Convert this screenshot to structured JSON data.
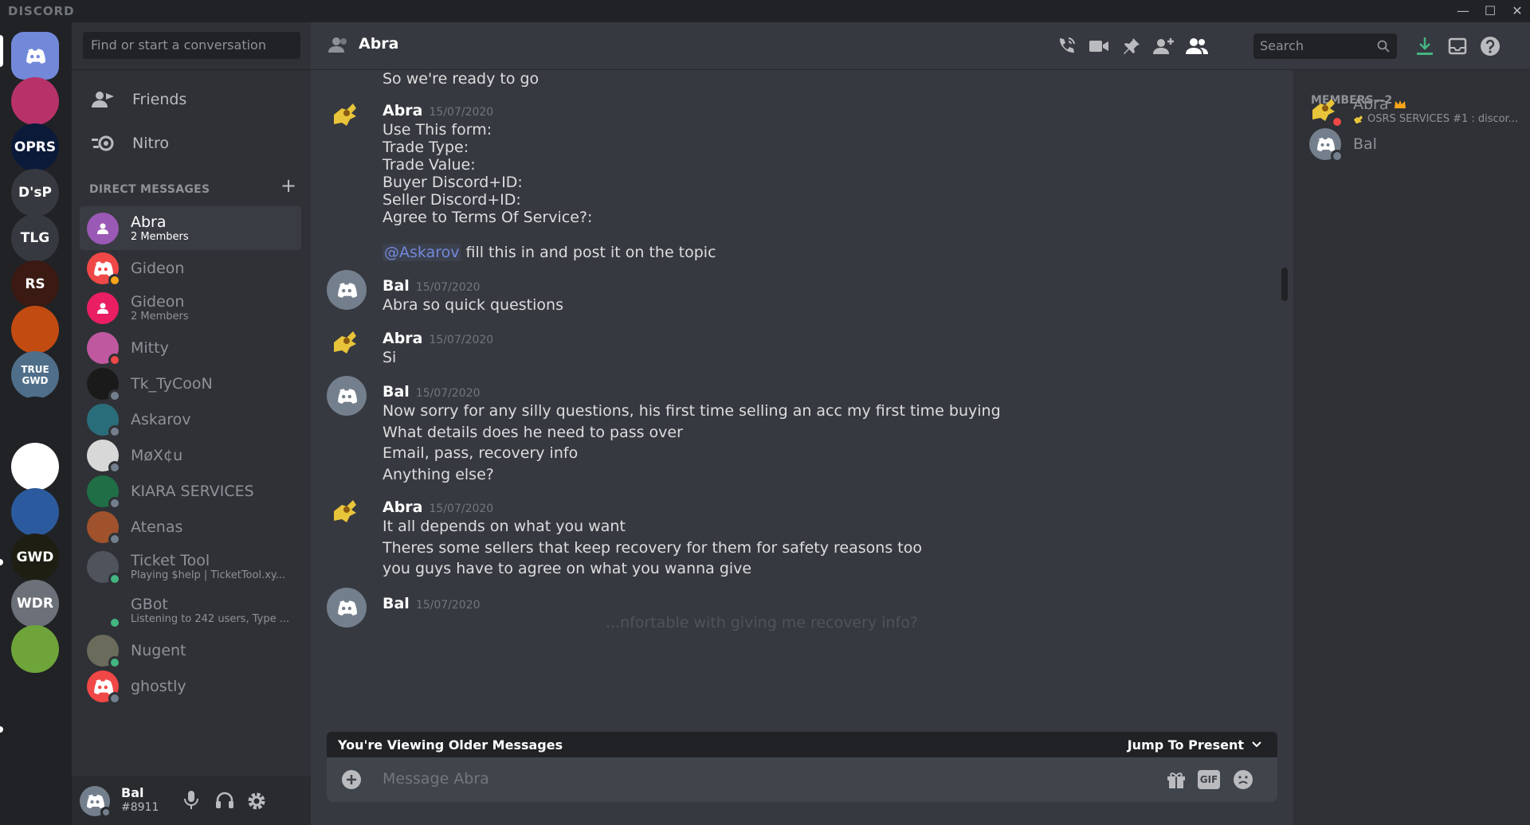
{
  "window": {
    "brand": "DISCORD",
    "minimize": "—",
    "maximize": "☐",
    "close": "✕"
  },
  "servers": [
    {
      "id": "home",
      "label": "",
      "color": "#7289da"
    },
    {
      "id": "s1",
      "label": "",
      "color": "#b8326a"
    },
    {
      "id": "s2",
      "label": "OPRS",
      "color": "#0c1a3a"
    },
    {
      "id": "s3",
      "label": "D'sP",
      "color": "#36393f"
    },
    {
      "id": "s4",
      "label": "TLG",
      "color": "#36393f"
    },
    {
      "id": "s5",
      "label": "RS",
      "color": "#3a1a12"
    },
    {
      "id": "s6",
      "label": "",
      "color": "#c24b12"
    },
    {
      "id": "s7",
      "label": "TRUE GWD",
      "color": "#4f6e8a"
    },
    {
      "id": "s8",
      "label": "",
      "color": "#202225"
    },
    {
      "id": "s9",
      "label": "",
      "color": "#ffffff"
    },
    {
      "id": "s10",
      "label": "",
      "color": "#2c5a9e"
    },
    {
      "id": "s11",
      "label": "GWD",
      "color": "#1e1e12"
    },
    {
      "id": "s12",
      "label": "WDR",
      "color": "#6c7078"
    },
    {
      "id": "s13",
      "label": "",
      "color": "#6ea43a"
    }
  ],
  "dm_panel": {
    "search_placeholder": "Find or start a conversation",
    "friends": "Friends",
    "nitro": "Nitro",
    "section": "DIRECT MESSAGES",
    "add": "+",
    "items": [
      {
        "name": "Abra",
        "sub": "2 Members",
        "color": "#9b59b6",
        "status": "",
        "active": true
      },
      {
        "name": "Gideon",
        "sub": "",
        "color": "#f04747",
        "status": "#faa61a",
        "active": false
      },
      {
        "name": "Gideon",
        "sub": "2 Members",
        "color": "#e91e63",
        "status": "",
        "active": false
      },
      {
        "name": "Mitty",
        "sub": "",
        "color": "#c0589f",
        "status": "#f04747",
        "active": false
      },
      {
        "name": "Tk_TyCooN",
        "sub": "",
        "color": "#1a1a1a",
        "status": "#747f8d",
        "active": false
      },
      {
        "name": "Askarov",
        "sub": "",
        "color": "#2a6d7a",
        "status": "#747f8d",
        "active": false
      },
      {
        "name": "MøX¢u",
        "sub": "",
        "color": "#d8d8d8",
        "status": "#747f8d",
        "active": false
      },
      {
        "name": "KIARA SERVICES",
        "sub": "",
        "color": "#1f6e45",
        "status": "#747f8d",
        "active": false
      },
      {
        "name": "Atenas",
        "sub": "",
        "color": "#a0522d",
        "status": "#747f8d",
        "active": false
      },
      {
        "name": "Ticket Tool",
        "sub": "Playing $help | TicketTool.xy...",
        "color": "#4f545c",
        "status": "#43b581",
        "active": false
      },
      {
        "name": "GBot",
        "sub": "Listening to 242 users, Type ...",
        "color": "#2f3136",
        "status": "#43b581",
        "active": false
      },
      {
        "name": "Nugent",
        "sub": "",
        "color": "#6b6b5b",
        "status": "#43b581",
        "active": false
      },
      {
        "name": "ghostly",
        "sub": "",
        "color": "#f04747",
        "status": "#747f8d",
        "active": false
      }
    ]
  },
  "user": {
    "name": "Bal",
    "tag": "#8911"
  },
  "header": {
    "channel": "Abra",
    "search_placeholder": "Search"
  },
  "messages": [
    {
      "author": "",
      "time": "",
      "lines": [
        "So we're ready to go"
      ]
    },
    {
      "author": "Abra",
      "time": "15/07/2020",
      "lines": [
        "Use This form:",
        "Trade Type:",
        "Trade Value:",
        "Buyer Discord+ID:",
        "Seller Discord+ID:",
        "Agree to Terms Of Service?:"
      ]
    },
    {
      "author": "",
      "time": "",
      "mention": "@Askarov",
      "lines": [
        "fill this in and post it on the topic"
      ]
    },
    {
      "author": "Bal",
      "time": "15/07/2020",
      "lines": [
        "Abra so quick questions"
      ]
    },
    {
      "author": "Abra",
      "time": "15/07/2020",
      "lines": [
        "Si"
      ]
    },
    {
      "author": "Bal",
      "time": "15/07/2020",
      "lines": [
        "Now sorry for any silly questions, his first time selling an acc my first time buying",
        "What details does he need to pass over",
        "Email, pass, recovery info",
        "Anything else?"
      ]
    },
    {
      "author": "Abra",
      "time": "15/07/2020",
      "lines": [
        "It all depends on what you want",
        "Theres some sellers that keep recovery for them for safety reasons too",
        "you guys have to agree on what you wanna give"
      ]
    },
    {
      "author": "Bal",
      "time": "15/07/2020",
      "lines": [
        "...nfortable with giving me recovery info?"
      ]
    }
  ],
  "older_bar": {
    "left": "You're Viewing Older Messages",
    "right": "Jump To Present"
  },
  "composer": {
    "placeholder": "Message Abra",
    "gif": "GIF"
  },
  "members": {
    "heading": "MEMBERS—2",
    "list": [
      {
        "name": "Abra",
        "activity": "OSRS SERVICES #1 : discor...",
        "owner": true,
        "status": "#f04747"
      },
      {
        "name": "Bal",
        "activity": "",
        "owner": false,
        "status": "#747f8d"
      }
    ]
  },
  "colors": {
    "accent": "#7289da",
    "online": "#43b581",
    "idle": "#faa61a",
    "dnd": "#f04747",
    "offline": "#747f8d",
    "download": "#43b581"
  }
}
